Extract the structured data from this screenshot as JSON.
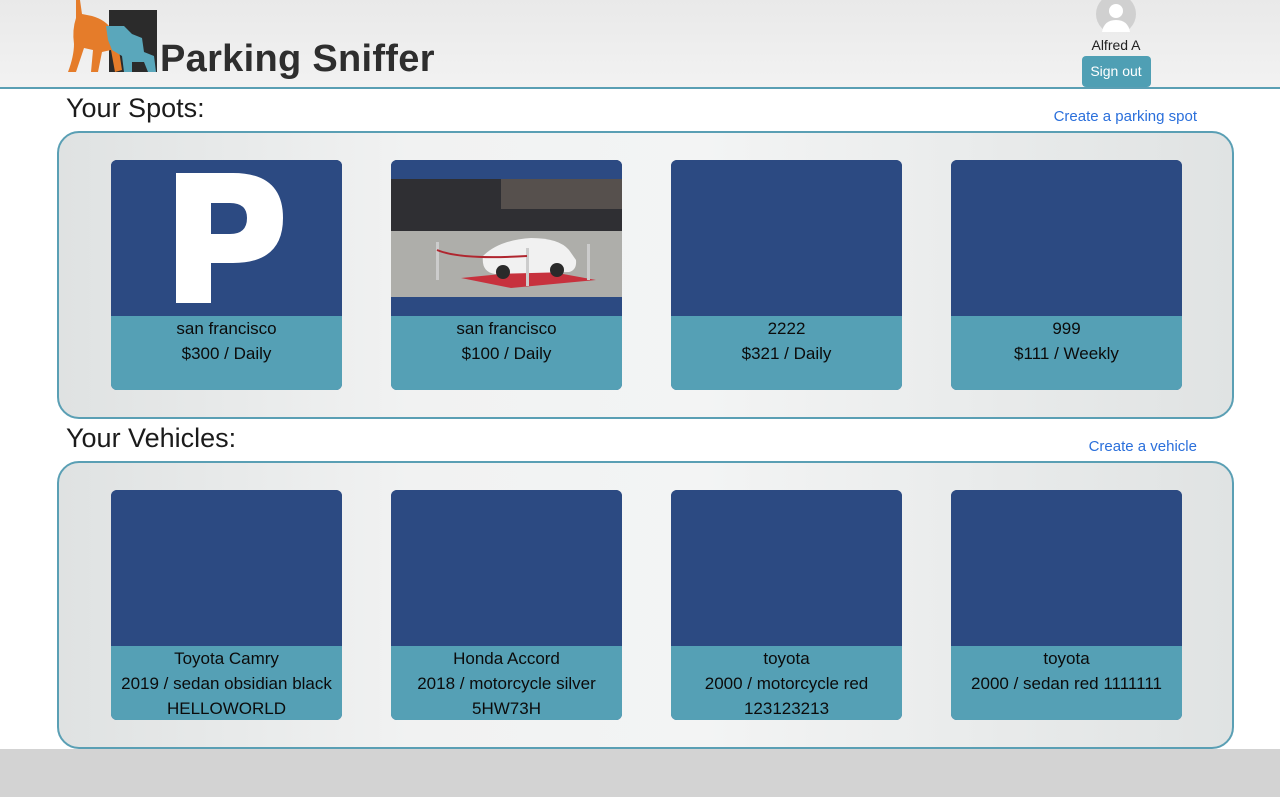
{
  "header": {
    "brand": "Parking Sniffer",
    "user_name": "Alfred A",
    "signout_label": "Sign out"
  },
  "spots_section": {
    "title": "Your Spots:",
    "create_label": "Create a parking spot",
    "cards": [
      {
        "line1": "san francisco",
        "line2": "$300 / Daily",
        "image": "parking-sign-image"
      },
      {
        "line1": "san francisco",
        "line2": "$100 / Daily",
        "image": "white-car-photo"
      },
      {
        "line1": "2222",
        "line2": "$321 / Daily",
        "image": "blank"
      },
      {
        "line1": "999",
        "line2": "$111 / Weekly",
        "image": "blank"
      }
    ]
  },
  "vehicles_section": {
    "title": "Your Vehicles:",
    "create_label": "Create a vehicle",
    "cards": [
      {
        "line1": "Toyota Camry",
        "line2": "2019 / sedan obsidian black",
        "line3": "HELLOWORLD"
      },
      {
        "line1": "Honda Accord",
        "line2": "2018 / motorcycle silver",
        "line3": "5HW73H"
      },
      {
        "line1": "toyota",
        "line2": "2000 / motorcycle red",
        "line3": "123123213"
      },
      {
        "line1": "toyota",
        "line2": "2000 / sedan red 1111111",
        "line3": ""
      }
    ]
  },
  "colors": {
    "accent": "#55a0b5",
    "card_blue": "#2c4a82",
    "link": "#2a6fdb"
  }
}
